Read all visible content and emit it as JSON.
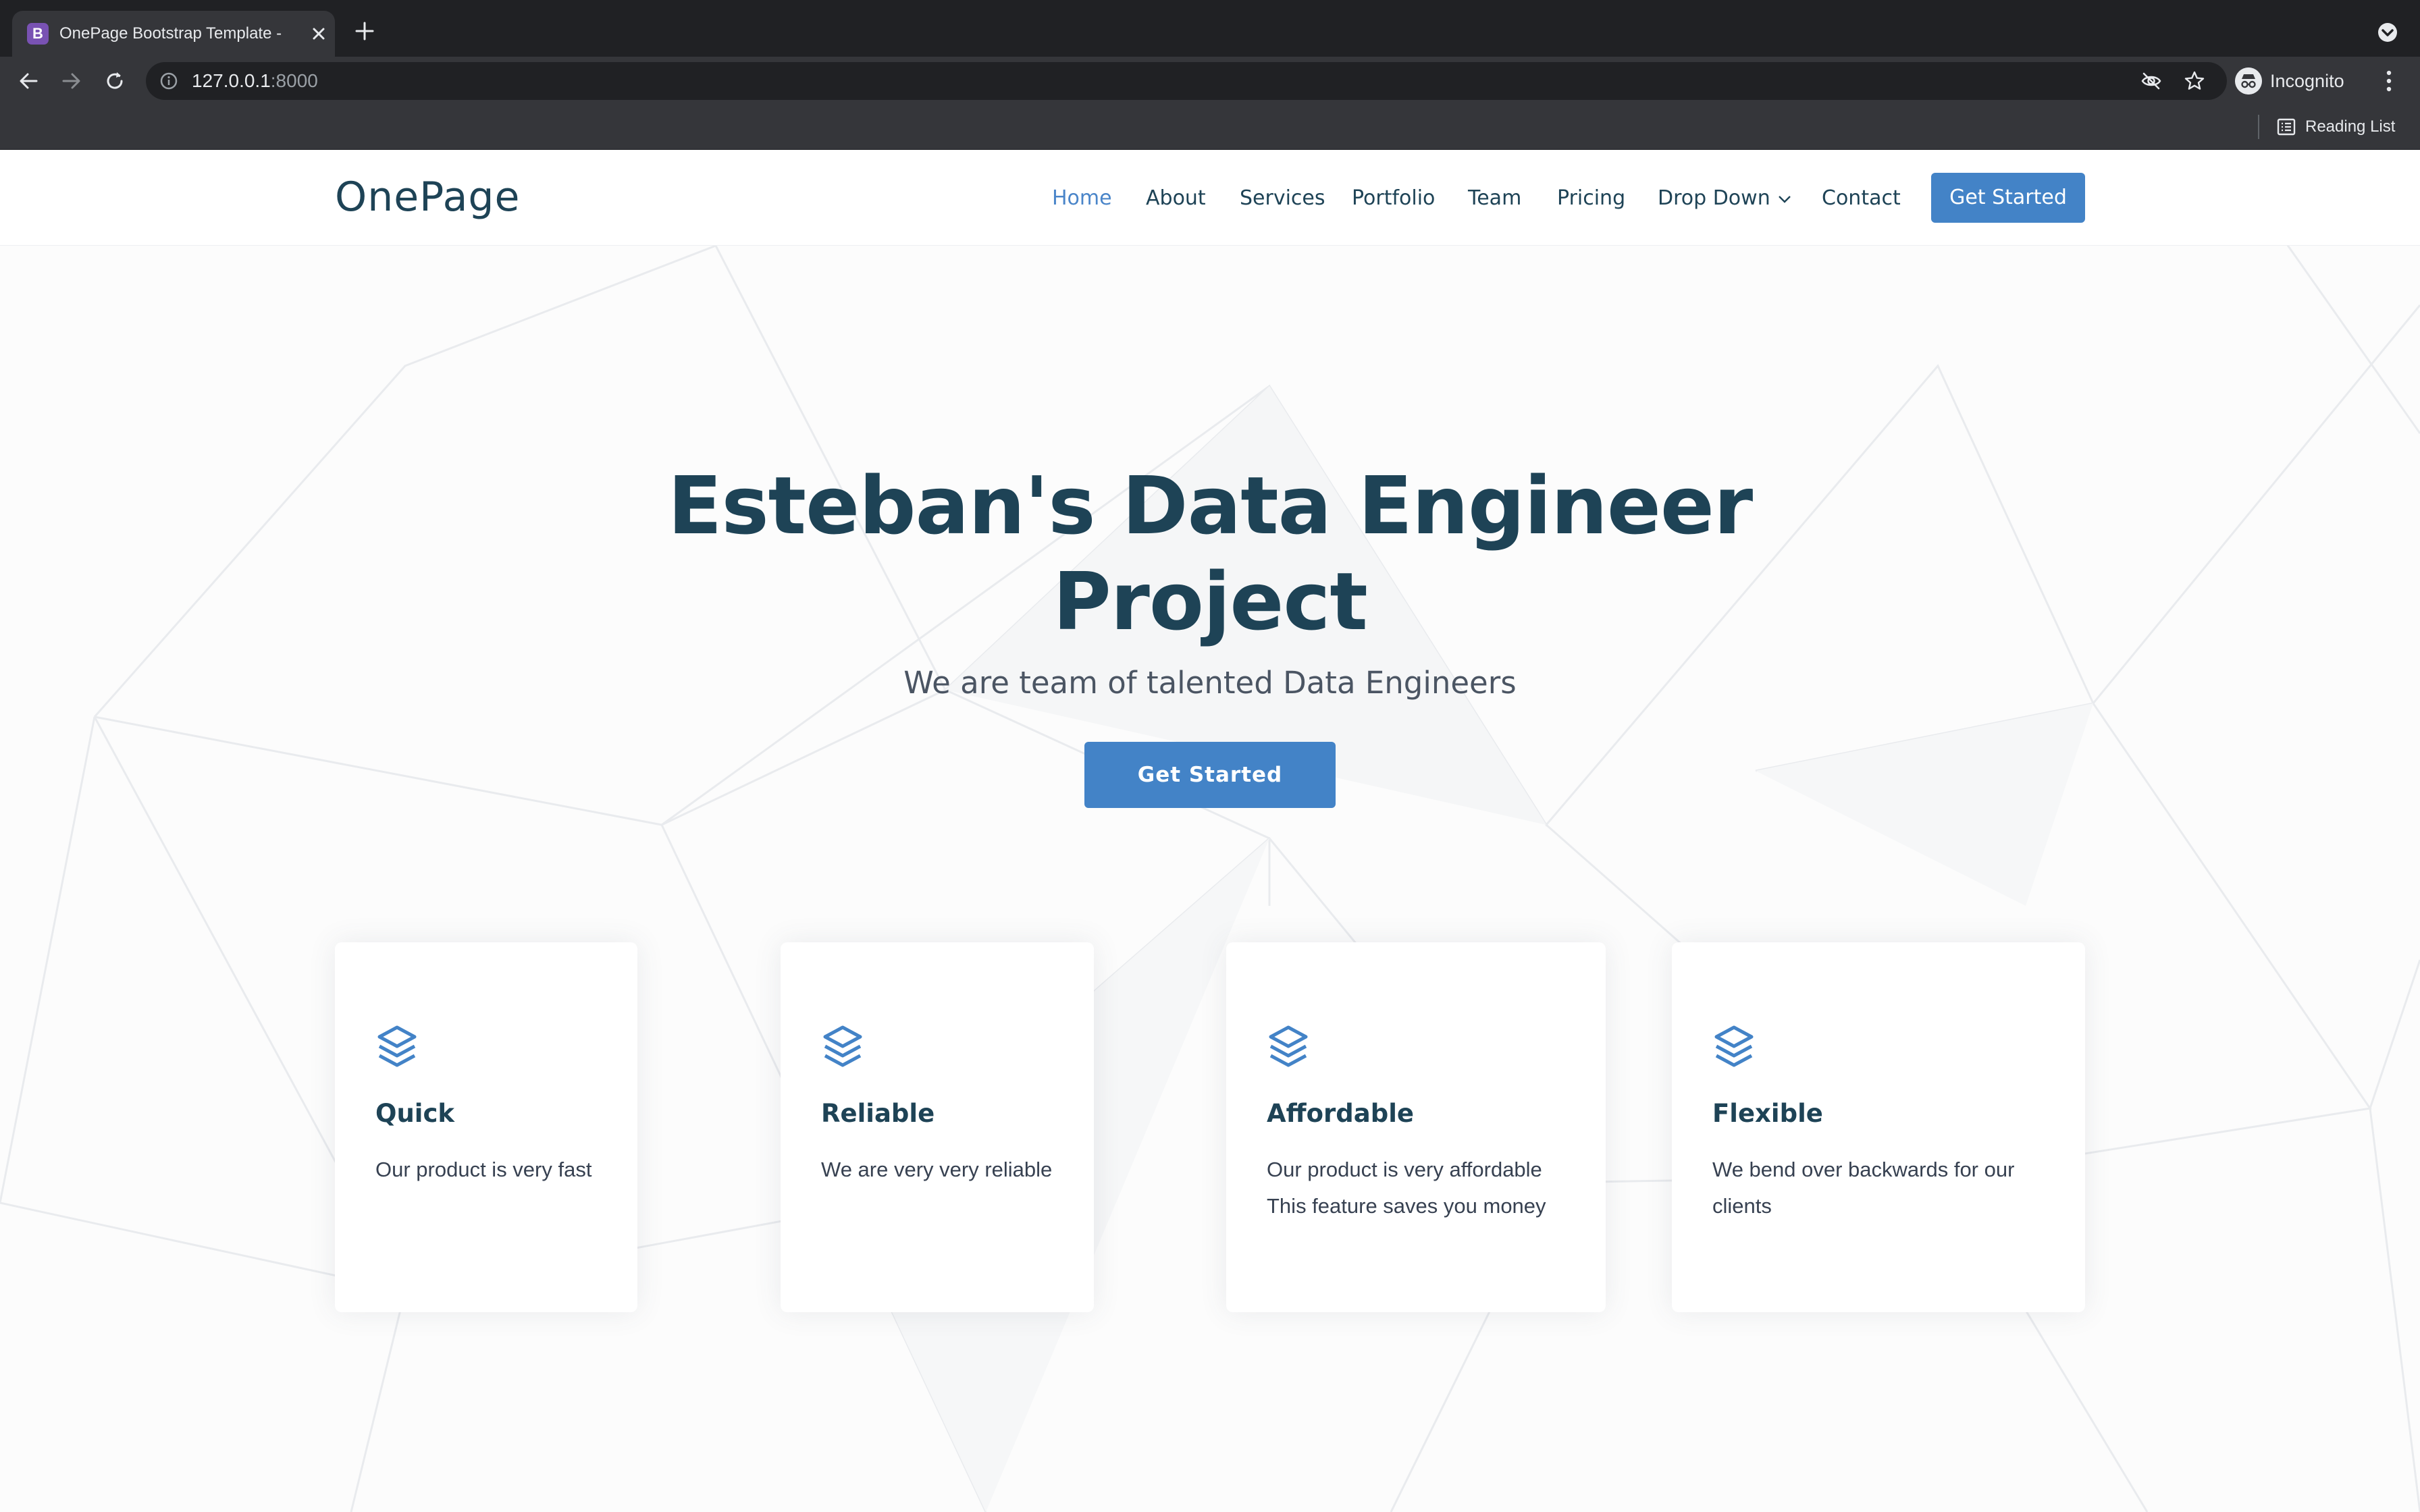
{
  "browser": {
    "tab_title": "OnePage Bootstrap Template - ",
    "tab_favicon": "B",
    "url_host": "127.0.0.1",
    "url_port": ":8000",
    "profile_label": "Incognito",
    "reading_list_label": "Reading List",
    "icons": [
      "close-icon",
      "plus-icon",
      "back-arrow-icon",
      "forward-arrow-icon",
      "reload-icon",
      "info-icon",
      "eye-off-icon",
      "star-icon",
      "incognito-icon",
      "kebab-menu-icon",
      "reading-list-icon",
      "tab-search-icon"
    ]
  },
  "site": {
    "logo": "OnePage",
    "nav": {
      "home": "Home",
      "about": "About",
      "services": "Services",
      "portfolio": "Portfolio",
      "team": "Team",
      "pricing": "Pricing",
      "dropdown": "Drop Down",
      "contact": "Contact",
      "cta": "Get Started",
      "active": "Home"
    },
    "accent_color": "#4383c7",
    "heading_color": "#1e4356"
  },
  "hero": {
    "title_line1": "Esteban's Data Engineer",
    "title_line2": "Project",
    "subtitle": "We are team of talented Data Engineers",
    "cta": "Get Started"
  },
  "features": [
    {
      "icon": "layers-icon",
      "title": "Quick",
      "lines": [
        "Our product is very fast"
      ]
    },
    {
      "icon": "layers-icon",
      "title": "Reliable",
      "lines": [
        "We are very very reliable"
      ]
    },
    {
      "icon": "layers-icon",
      "title": "Affordable",
      "lines": [
        "Our product is very affordable",
        "This feature saves you money"
      ]
    },
    {
      "icon": "layers-icon",
      "title": "Flexible",
      "lines": [
        "We bend over backwards for our",
        "clients"
      ]
    }
  ]
}
